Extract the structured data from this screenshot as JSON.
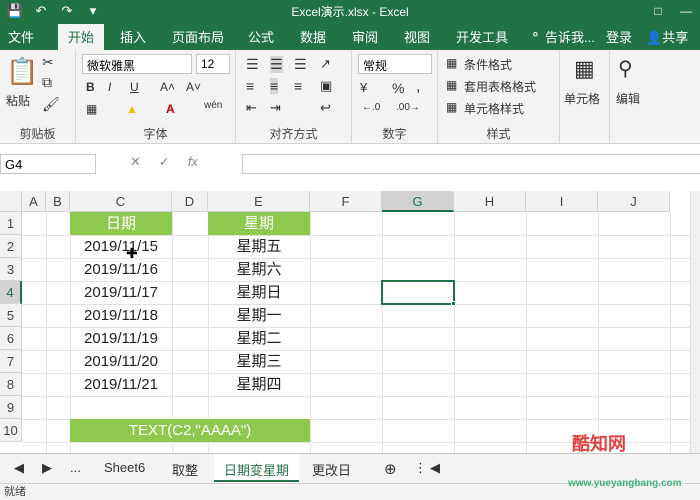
{
  "window": {
    "title": "Excel演示.xlsx - Excel",
    "qat": [
      "save-icon",
      "undo-icon",
      "redo-icon",
      "more-icon"
    ]
  },
  "tabs": [
    "文件",
    "开始",
    "插入",
    "页面布局",
    "公式",
    "数据",
    "审阅",
    "视图",
    "开发工具"
  ],
  "tabbar_right": {
    "tell_me": "告诉我...",
    "login": "登录",
    "share": "共享"
  },
  "ribbon": {
    "clipboard": {
      "paste": "粘贴",
      "label": "剪贴板"
    },
    "font": {
      "name": "微软雅黑",
      "size": "12",
      "bold": "B",
      "italic": "I",
      "underline": "U",
      "wen": "wén",
      "label": "字体"
    },
    "alignment": {
      "label": "对齐方式"
    },
    "number": {
      "format": "常规",
      "percent": "%",
      "comma": ",",
      "label": "数字"
    },
    "styles": {
      "conditional": "条件格式",
      "table": "套用表格格式",
      "cell": "单元格样式",
      "label": "样式"
    },
    "cells": {
      "label": "单元格"
    },
    "editing": {
      "label": "编辑"
    }
  },
  "formula_bar": {
    "namebox": "G4",
    "fx": "fx",
    "content": ""
  },
  "columns": [
    "A",
    "B",
    "C",
    "D",
    "E",
    "F",
    "G",
    "H",
    "I",
    "J"
  ],
  "rows": [
    "1",
    "2",
    "3",
    "4",
    "5",
    "6",
    "7",
    "8",
    "9",
    "10"
  ],
  "cells": {
    "C1": "日期",
    "E1": "星期",
    "C2": "2019/11/15",
    "E2": "星期五",
    "C3": "2019/11/16",
    "E3": "星期六",
    "C4": "2019/11/17",
    "E4": "星期日",
    "C5": "2019/11/18",
    "E5": "星期一",
    "C6": "2019/11/19",
    "E6": "星期二",
    "C7": "2019/11/20",
    "E7": "星期三",
    "C8": "2019/11/21",
    "E8": "星期四",
    "C10": "TEXT(C2,\"AAAA\")"
  },
  "sheet_tabs": [
    "...",
    "Sheet6",
    "取整",
    "日期变星期",
    "更改日"
  ],
  "active_sheet": "日期变星期",
  "status": "就绪",
  "watermark": {
    "text": "酷知网",
    "sub": "www.yueyangbang.com"
  },
  "colors": {
    "brand": "#217346",
    "header_green": "#8dc84f"
  }
}
